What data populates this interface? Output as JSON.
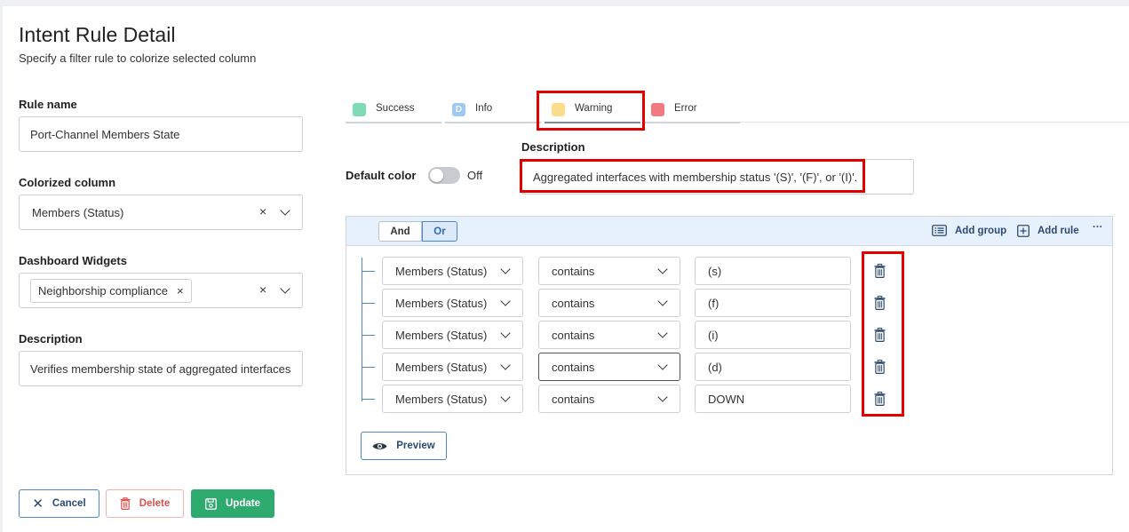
{
  "header": {
    "title": "Intent Rule Detail",
    "subtitle": "Specify a filter rule to colorize selected column"
  },
  "form": {
    "rule_name_label": "Rule name",
    "rule_name_value": "Port-Channel Members State",
    "colorized_column_label": "Colorized column",
    "colorized_column_value": "Members (Status)",
    "dashboard_widgets_label": "Dashboard Widgets",
    "dashboard_widgets_chip": "Neighborship compliance",
    "description_label": "Description",
    "description_value": "Verifies membership state of aggregated interfaces",
    "clear_symbol": "×"
  },
  "tabs": [
    {
      "label": "Success",
      "color": "#7fdbb6",
      "badge": ""
    },
    {
      "label": "Info",
      "color": "#9ec9f2",
      "badge": "D"
    },
    {
      "label": "Warning",
      "color": "#f9dd8c",
      "badge": ""
    },
    {
      "label": "Error",
      "color": "#f07a7f",
      "badge": ""
    }
  ],
  "active_tab": "Warning",
  "severity": {
    "description_label": "Description",
    "description_value": "Aggregated interfaces with membership status '(S)', '(F)', or '(I)'.",
    "default_color_label": "Default color",
    "default_color_state": "Off"
  },
  "query": {
    "and_label": "And",
    "or_label": "Or",
    "selected_combinator": "Or",
    "add_group_label": "Add group",
    "add_rule_label": "Add rule",
    "more_label": "···",
    "rules": [
      {
        "field": "Members (Status)",
        "operator": "contains",
        "value": "(s)"
      },
      {
        "field": "Members (Status)",
        "operator": "contains",
        "value": "(f)"
      },
      {
        "field": "Members (Status)",
        "operator": "contains",
        "value": "(i)"
      },
      {
        "field": "Members (Status)",
        "operator": "contains",
        "value": "(d)"
      },
      {
        "field": "Members (Status)",
        "operator": "contains",
        "value": "DOWN"
      }
    ],
    "preview_label": "Preview"
  },
  "footer": {
    "cancel_label": "Cancel",
    "delete_label": "Delete",
    "update_label": "Update"
  },
  "colors": {
    "accent": "#2b4a72",
    "update_green": "#2dab6f",
    "delete_red": "#d9534f",
    "highlight_red": "#e00000"
  }
}
